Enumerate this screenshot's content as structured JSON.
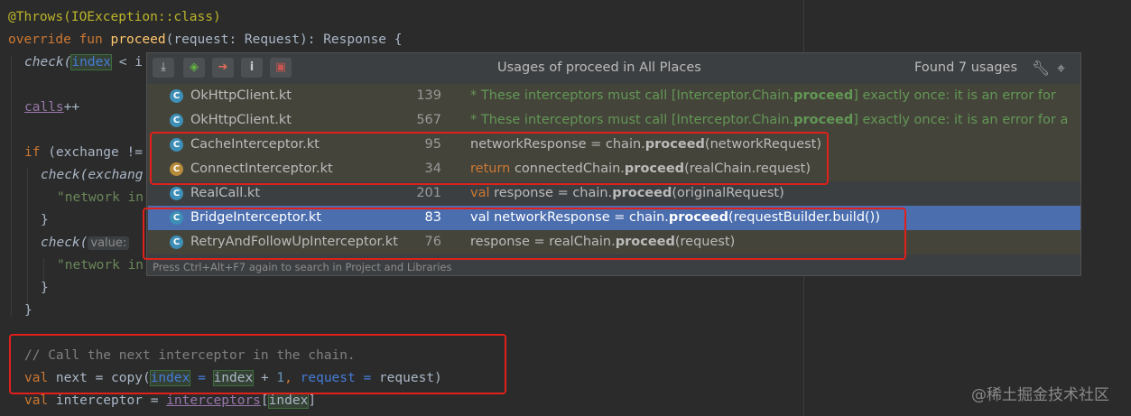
{
  "editor": {
    "lines": [
      {
        "text": "@Throws(IOException::class)"
      },
      {
        "kw": "override fun",
        "fn": "proceed",
        "rest": "(request: Request): Response {"
      },
      {
        "pre": "check(",
        "hl": "index",
        "post": " < i"
      },
      {
        "field": "calls",
        "post": "++"
      },
      {
        "kw": "if",
        "pre": " (exchange !="
      },
      {
        "pre": "check(exchang"
      },
      {
        "str": "\"network in"
      },
      {
        "text": "}"
      },
      {
        "pre": "check(",
        "hint": "value:"
      },
      {
        "str": "\"network in"
      },
      {
        "text": "}"
      },
      {
        "text": "}"
      },
      {
        "comment": "// Call the next interceptor in the chain."
      },
      {
        "kw": "val",
        "pre": " next = copy(",
        "p1": "index",
        "eq": " = ",
        "p2": "index",
        "plus": " + ",
        "num": "1",
        "comma": ", ",
        "p3": "request",
        "eq2": " = ",
        "p4": "request",
        "close": ")"
      },
      {
        "kw": "val",
        "pre": " interceptor = ",
        "field": "interceptors",
        "open": "[",
        "hl": "index",
        "close": "]"
      }
    ]
  },
  "popup": {
    "title": "Usages of proceed in All Places",
    "count": "Found 7 usages",
    "footer": "Press Ctrl+Alt+F7 again to search in Project and Libraries",
    "rows": [
      {
        "file": "OkHttpClient.kt",
        "line": "139",
        "code_pre": "* These interceptors must call [Interceptor.Chain.",
        "code_bold": "proceed",
        "code_post": "] exactly once: it is an error for"
      },
      {
        "file": "OkHttpClient.kt",
        "line": "567",
        "code_pre": "* These interceptors must call [Interceptor.Chain.",
        "code_bold": "proceed",
        "code_post": "] exactly once: it is an error for a"
      },
      {
        "file": "CacheInterceptor.kt",
        "line": "95",
        "code_pre": "networkResponse = chain.",
        "code_bold": "proceed",
        "code_post": "(networkRequest)"
      },
      {
        "file": "ConnectInterceptor.kt",
        "line": "34",
        "code_kw": "return",
        "code_pre": " connectedChain.",
        "code_bold": "proceed",
        "code_post": "(realChain.request)"
      },
      {
        "file": "RealCall.kt",
        "line": "201",
        "code_kw": "val",
        "code_pre": " response = chain.",
        "code_bold": "proceed",
        "code_post": "(originalRequest)"
      },
      {
        "file": "BridgeInterceptor.kt",
        "line": "83",
        "code_kw": "val",
        "code_pre": " networkResponse = chain.",
        "code_bold": "proceed",
        "code_post": "(requestBuilder.build())"
      },
      {
        "file": "RetryAndFollowUpInterceptor.kt",
        "line": "76",
        "code_pre": "response = realChain.",
        "code_bold": "proceed",
        "code_post": "(request)"
      }
    ]
  },
  "watermark": "@稀土掘金技术社区"
}
